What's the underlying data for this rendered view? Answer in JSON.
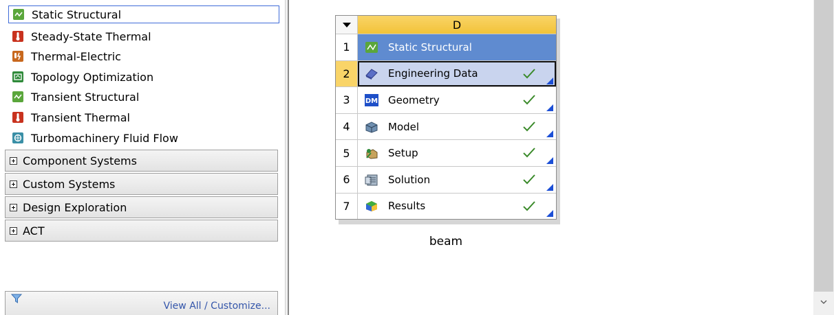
{
  "toolbox": {
    "items": [
      {
        "label": "Static Structural",
        "icon": "static-structural-icon",
        "color": "#5aa63b",
        "selected": true
      },
      {
        "label": "Steady-State Thermal",
        "icon": "thermal-icon",
        "color": "#c8321e"
      },
      {
        "label": "Thermal-Electric",
        "icon": "thermal-electric-icon",
        "color": "#c8681e"
      },
      {
        "label": "Topology Optimization",
        "icon": "topology-icon",
        "color": "#2f8a3a"
      },
      {
        "label": "Transient Structural",
        "icon": "transient-structural-icon",
        "color": "#5aa63b"
      },
      {
        "label": "Transient Thermal",
        "icon": "transient-thermal-icon",
        "color": "#c8321e"
      },
      {
        "label": "Turbomachinery Fluid Flow",
        "icon": "turbomachinery-icon",
        "color": "#3a8fa6"
      }
    ],
    "groups": [
      {
        "label": "Component Systems"
      },
      {
        "label": "Custom Systems"
      },
      {
        "label": "Design Exploration"
      },
      {
        "label": "ACT"
      }
    ],
    "footer": {
      "link": "View All / Customize..."
    }
  },
  "system": {
    "column_header": "D",
    "name": "beam",
    "rows": [
      {
        "num": "1",
        "label": "Static Structural",
        "icon": "static-structural-icon"
      },
      {
        "num": "2",
        "label": "Engineering Data",
        "icon": "engineering-data-icon",
        "status": "up-to-date"
      },
      {
        "num": "3",
        "label": "Geometry",
        "icon": "geometry-icon",
        "icon_text": "DM",
        "status": "up-to-date"
      },
      {
        "num": "4",
        "label": "Model",
        "icon": "model-icon",
        "status": "up-to-date"
      },
      {
        "num": "5",
        "label": "Setup",
        "icon": "setup-icon",
        "status": "up-to-date"
      },
      {
        "num": "6",
        "label": "Solution",
        "icon": "solution-icon",
        "status": "up-to-date"
      },
      {
        "num": "7",
        "label": "Results",
        "icon": "results-icon",
        "status": "up-to-date"
      }
    ]
  },
  "colors": {
    "title_bar": "#5f8bd0",
    "header_yellow": "#f2c338",
    "selection_blue": "#c9d4ee",
    "check_green": "#3a8a2a",
    "corner_blue": "#1c4fd6"
  }
}
